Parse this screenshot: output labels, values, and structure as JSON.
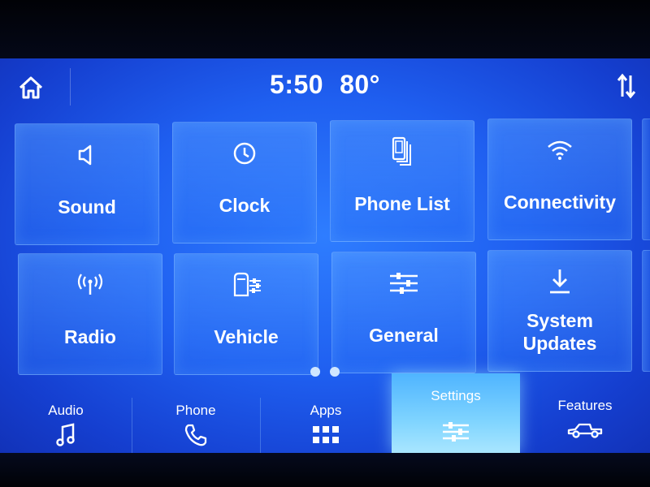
{
  "header": {
    "time": "5:50",
    "temperature": "80°",
    "home_icon": "home-icon",
    "sort_icon": "sort-arrows-icon"
  },
  "tiles": [
    {
      "label": "Sound",
      "icon": "speaker-icon"
    },
    {
      "label": "Clock",
      "icon": "clock-icon"
    },
    {
      "label": "Phone List",
      "icon": "phone-list-icon"
    },
    {
      "label": "Connectivity",
      "icon": "wifi-icon"
    },
    {
      "label": "Radio",
      "icon": "antenna-icon"
    },
    {
      "label": "Vehicle",
      "icon": "vehicle-settings-icon"
    },
    {
      "label": "General",
      "icon": "sliders-icon"
    },
    {
      "label": "System Updates",
      "icon": "download-icon"
    }
  ],
  "pagination": {
    "pages": 2,
    "current": 1
  },
  "nav": [
    {
      "label": "Audio",
      "icon": "music-note-icon"
    },
    {
      "label": "Phone",
      "icon": "phone-icon"
    },
    {
      "label": "Apps",
      "icon": "apps-grid-icon"
    },
    {
      "label": "Settings",
      "icon": "settings-sliders-icon",
      "active": true
    },
    {
      "label": "Features",
      "icon": "truck-icon"
    }
  ],
  "colors": {
    "screen": "#1f5ff0",
    "active_tab": "#7fd4ff",
    "text": "#ffffff"
  }
}
